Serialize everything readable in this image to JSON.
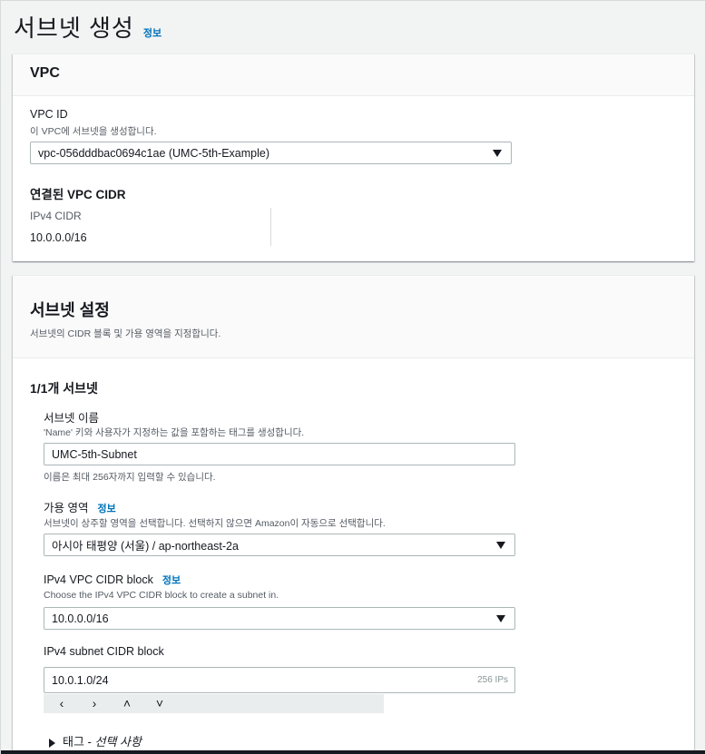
{
  "page": {
    "title": "서브넷 생성",
    "info": "정보"
  },
  "vpc_card": {
    "title": "VPC",
    "vpc_id_label": "VPC ID",
    "vpc_id_desc": "이 VPC에 서브넷을 생성합니다.",
    "vpc_id_value": "vpc-056dddbac0694c1ae (UMC-5th-Example)",
    "cidr_heading": "연결된 VPC CIDR",
    "ipv4_cidr_label": "IPv4 CIDR",
    "ipv4_cidr_value": "10.0.0.0/16"
  },
  "subnet_card": {
    "title": "서브넷 설정",
    "desc": "서브넷의 CIDR 블록 및 가용 영역을 지정합니다.",
    "count_label": "1/1개 서브넷",
    "name_label": "서브넷 이름",
    "name_desc": "'Name' 키와 사용자가 지정하는 값을 포함하는 태그를 생성합니다.",
    "name_value": "UMC-5th-Subnet",
    "name_hint": "이름은 최대 256자까지 입력할 수 있습니다.",
    "az_label": "가용 영역",
    "az_info": "정보",
    "az_desc": "서브넷이 상주할 영역을 선택합니다. 선택하지 않으면 Amazon이 자동으로 선택합니다.",
    "az_value": "아시아 태평양 (서울) / ap-northeast-2a",
    "vpc_cidr_label": "IPv4 VPC CIDR block",
    "vpc_cidr_info": "정보",
    "vpc_cidr_desc": "Choose the IPv4 VPC CIDR block to create a subnet in.",
    "vpc_cidr_value": "10.0.0.0/16",
    "subnet_cidr_label": "IPv4 subnet CIDR block",
    "subnet_cidr_value": "10.0.1.0/24",
    "subnet_cidr_suffix": "256 IPs",
    "stepper": [
      "‹",
      "›",
      "˄",
      "˅"
    ],
    "tags_label": "태그 - ",
    "tags_optional": "선택 사항"
  }
}
